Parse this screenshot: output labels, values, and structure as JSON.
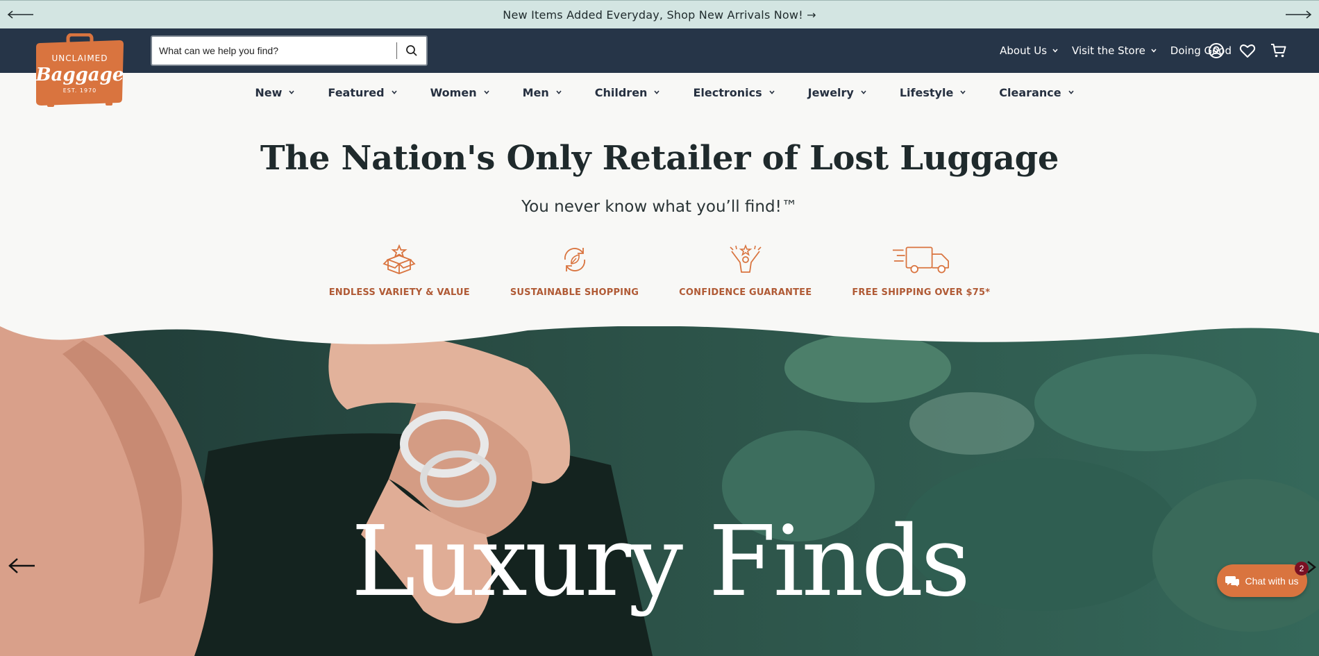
{
  "announcement": {
    "text": "New Items Added Everyday, Shop New Arrivals Now! →"
  },
  "brand": {
    "line1": "UNCLAIMED",
    "line2": "Baggage",
    "line3": "EST. 1970",
    "color": "#d9743f"
  },
  "search": {
    "placeholder": "What can we help you find?"
  },
  "header_nav": [
    {
      "label": "About Us"
    },
    {
      "label": "Visit the Store"
    },
    {
      "label": "Doing Good"
    }
  ],
  "header_icons": [
    "account-icon",
    "heart-icon",
    "cart-icon"
  ],
  "categories": [
    {
      "label": "New"
    },
    {
      "label": "Featured"
    },
    {
      "label": "Women"
    },
    {
      "label": "Men"
    },
    {
      "label": "Children"
    },
    {
      "label": "Electronics"
    },
    {
      "label": "Jewelry"
    },
    {
      "label": "Lifestyle"
    },
    {
      "label": "Clearance"
    }
  ],
  "hero": {
    "title": "The Nation's Only Retailer of Lost Luggage",
    "subtitle": "You never know what you’ll find!™",
    "headline": "Luxury Finds"
  },
  "value_props": [
    {
      "label": "ENDLESS VARIETY & VALUE",
      "icon": "open-box-star-icon"
    },
    {
      "label": "SUSTAINABLE SHOPPING",
      "icon": "recycle-leaf-icon"
    },
    {
      "label": "CONFIDENCE GUARANTEE",
      "icon": "person-star-icon"
    },
    {
      "label": "FREE SHIPPING OVER $75*",
      "icon": "delivery-truck-icon"
    }
  ],
  "chat": {
    "label": "Chat with us",
    "badge": "2"
  },
  "colors": {
    "announce_bg": "#d3e5e2",
    "header_bg": "#263548",
    "accent": "#b05a35",
    "page_bg": "#f8f8f6"
  }
}
